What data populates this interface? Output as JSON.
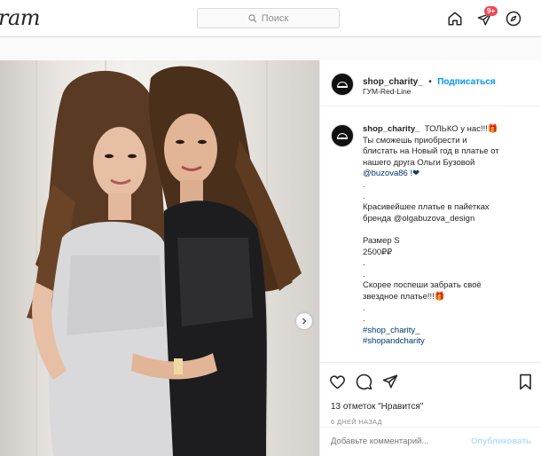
{
  "topbar": {
    "logo": "ram",
    "search_placeholder": "Поиск",
    "notifications_badge": "9+"
  },
  "post": {
    "username": "shop_charity_",
    "separator": "•",
    "follow_label": "Подписаться",
    "location": "ГУМ-Red-Line",
    "caption_lines": [
      "ТОЛЬКО у нас!!!🎁",
      "Ты сможешь приобрести и",
      "блистать на Новый год в платье от",
      "нашего друга Ольги Бузовой",
      "@buzova86 !❤",
      ".",
      ".",
      "Красивейшее платье в пайетках",
      "бренда @olgabuzova_design",
      "",
      "Размер S",
      "2500₽₽",
      ".",
      ".",
      "Скорее поспеши забрать своё",
      "звездное платье!!!🎁",
      ".",
      ".",
      "#shop_charity_",
      "#shopandcharity"
    ],
    "likes_count": "13 отметок",
    "likes_label": "\"Нравится\"",
    "time_ago": "6 ДНЕЙ НАЗАД",
    "comment_placeholder": "Добавьте комментарий...",
    "publish_label": "Опубликовать"
  },
  "colors": {
    "accent": "#0095f6",
    "link": "#00376b",
    "badge": "#ed4956"
  },
  "icons": [
    "search-icon",
    "home-icon",
    "direct-icon",
    "explore-icon",
    "heart-icon",
    "comment-icon",
    "share-icon",
    "bookmark-icon",
    "chevron-right-icon"
  ]
}
